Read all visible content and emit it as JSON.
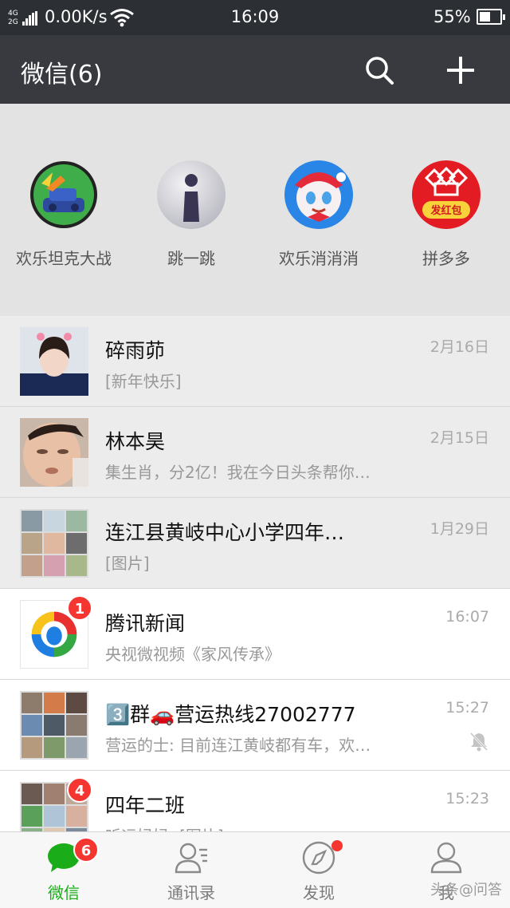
{
  "status_bar": {
    "network_top": "4G",
    "network_bottom": "2G",
    "speed": "0.00K/s",
    "time": "16:09",
    "battery_text": "55%",
    "battery_level": 0.55
  },
  "header": {
    "title": "微信(6)",
    "search_icon": "search-icon",
    "add_icon": "plus-icon"
  },
  "mini_programs": [
    {
      "label": "欢乐坦克大战",
      "icon": "tank-game-icon"
    },
    {
      "label": "跳一跳",
      "icon": "jump-game-icon"
    },
    {
      "label": "欢乐消消消",
      "icon": "match-game-icon"
    },
    {
      "label": "拼多多",
      "icon": "pinduoduo-icon",
      "icon_text": "发红包"
    }
  ],
  "chats": [
    {
      "name": "碎雨茆",
      "preview": "[新年快乐]",
      "time": "2月16日",
      "pinned": true
    },
    {
      "name": "林本昊",
      "preview": "集生肖，分2亿！我在今日头条帮你…",
      "time": "2月15日",
      "pinned": true
    },
    {
      "name": "连江县黄岐中心小学四年…",
      "preview": "[图片]",
      "time": "1月29日",
      "pinned": true
    },
    {
      "name": "腾讯新闻",
      "preview": "央视微视频《家风传承》",
      "time": "16:07",
      "pinned": false,
      "badge": "1"
    },
    {
      "name": "3️⃣群🚗营运热线27002777",
      "preview": "营运的士: 目前连江黄岐都有车，欢…",
      "time": "15:27",
      "pinned": false,
      "muted": true
    },
    {
      "name": "四年二班",
      "preview": "听远妈妈: [图片]",
      "time": "15:23",
      "pinned": false,
      "badge": "4"
    }
  ],
  "tabs": [
    {
      "label": "微信",
      "icon": "chat-bubble-icon",
      "active": true,
      "badge": "6"
    },
    {
      "label": "通讯录",
      "icon": "contacts-icon",
      "active": false
    },
    {
      "label": "发现",
      "icon": "compass-icon",
      "active": false,
      "dot": true
    },
    {
      "label": "我",
      "icon": "person-icon",
      "active": false
    }
  ],
  "watermark": "头条@问答",
  "colors": {
    "accent_green": "#1aad19",
    "badge_red": "#f43530",
    "header_bg": "#393a3f"
  }
}
